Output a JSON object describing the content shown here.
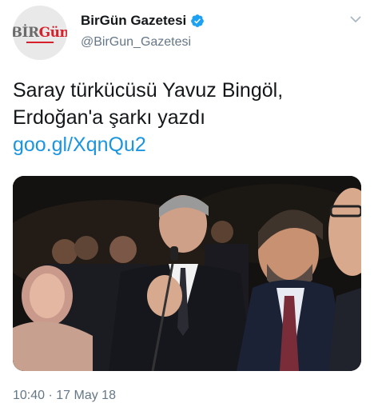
{
  "tweet": {
    "avatar": {
      "logo_part1": "BİR",
      "logo_part2": "Gün",
      "brand_color": "#d8202b"
    },
    "display_name": "BirGün Gazetesi",
    "handle": "@BirGun_Gazetesi",
    "verified_icon": "verified-badge-icon",
    "menu_icon": "chevron-down-icon",
    "text_line1": "Saray türkücüsü Yavuz Bingöl,",
    "text_line2": "Erdoğan'a şarkı yazdı",
    "link": "goo.gl/XqnQu2",
    "link_color": "#1b95e0",
    "timestamp": "10:40 · 17 May 18"
  }
}
